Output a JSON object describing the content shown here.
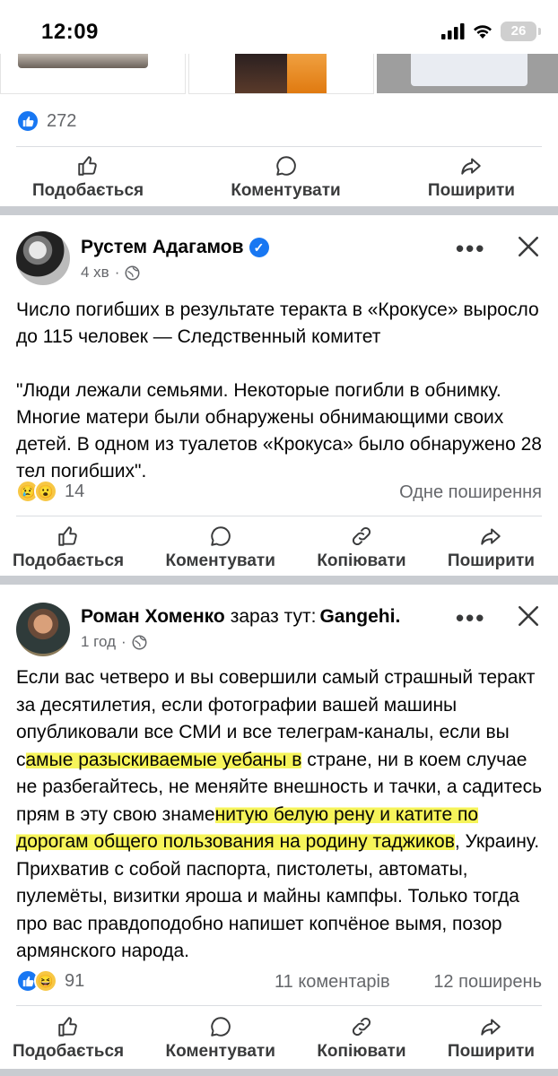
{
  "status_bar": {
    "time": "12:09",
    "battery": "26"
  },
  "prev_post": {
    "reaction_count": "272",
    "actions": {
      "like": "Подобається",
      "comment": "Коментувати",
      "share": "Поширити"
    }
  },
  "post1": {
    "author": "Рустем Адагамов",
    "time": "4 хв",
    "text_line1": "Число погибших в результате теракта в «Крокусе» выросло до 115 человек — Следственный комитет",
    "text_quote": "\"Люди лежали семьями. Некоторые погибли в обнимку. Многие матери были обнаружены обнимающими своих детей. В одном из туалетов «Крокуса» было обнаружено 28 тел погибших\".",
    "reaction_count": "14",
    "shares": "Одне поширення",
    "actions": {
      "like": "Подобається",
      "comment": "Коментувати",
      "copy": "Копіювати",
      "share": "Поширити"
    }
  },
  "post2": {
    "author": "Роман Хоменко",
    "location_prefix": "зараз тут:",
    "location": "Gangehi",
    "time": "1 год",
    "text_a": "Если вас четверо и вы совершили самый страшный теракт за десятилетия, если фотографии вашей машины опубликовали все СМИ и все телеграм-каналы, если вы с",
    "text_hl1": "амые разыскиваемые уебаны в",
    "text_b": " стране, ни в коем случае не разбегайтесь, не меняйте внешность и тачки, а садитесь прям в эту свою знаме",
    "text_hl2": "нитую белую рену и катите по дорогам общего пользования на родину таджиков",
    "text_c": ", Украину. Прихватив с собой паспорта, пистолеты, автоматы, пулемёты, визитки яроша и майны кампфы. Только тогда про вас правдоподобно напишет копчёное вымя, позор армянского народа.",
    "reaction_count": "91",
    "comments": "11 коментарів",
    "shares": "12 поширень",
    "actions": {
      "like": "Подобається",
      "comment": "Коментувати",
      "copy": "Копіювати",
      "share": "Поширити"
    }
  }
}
